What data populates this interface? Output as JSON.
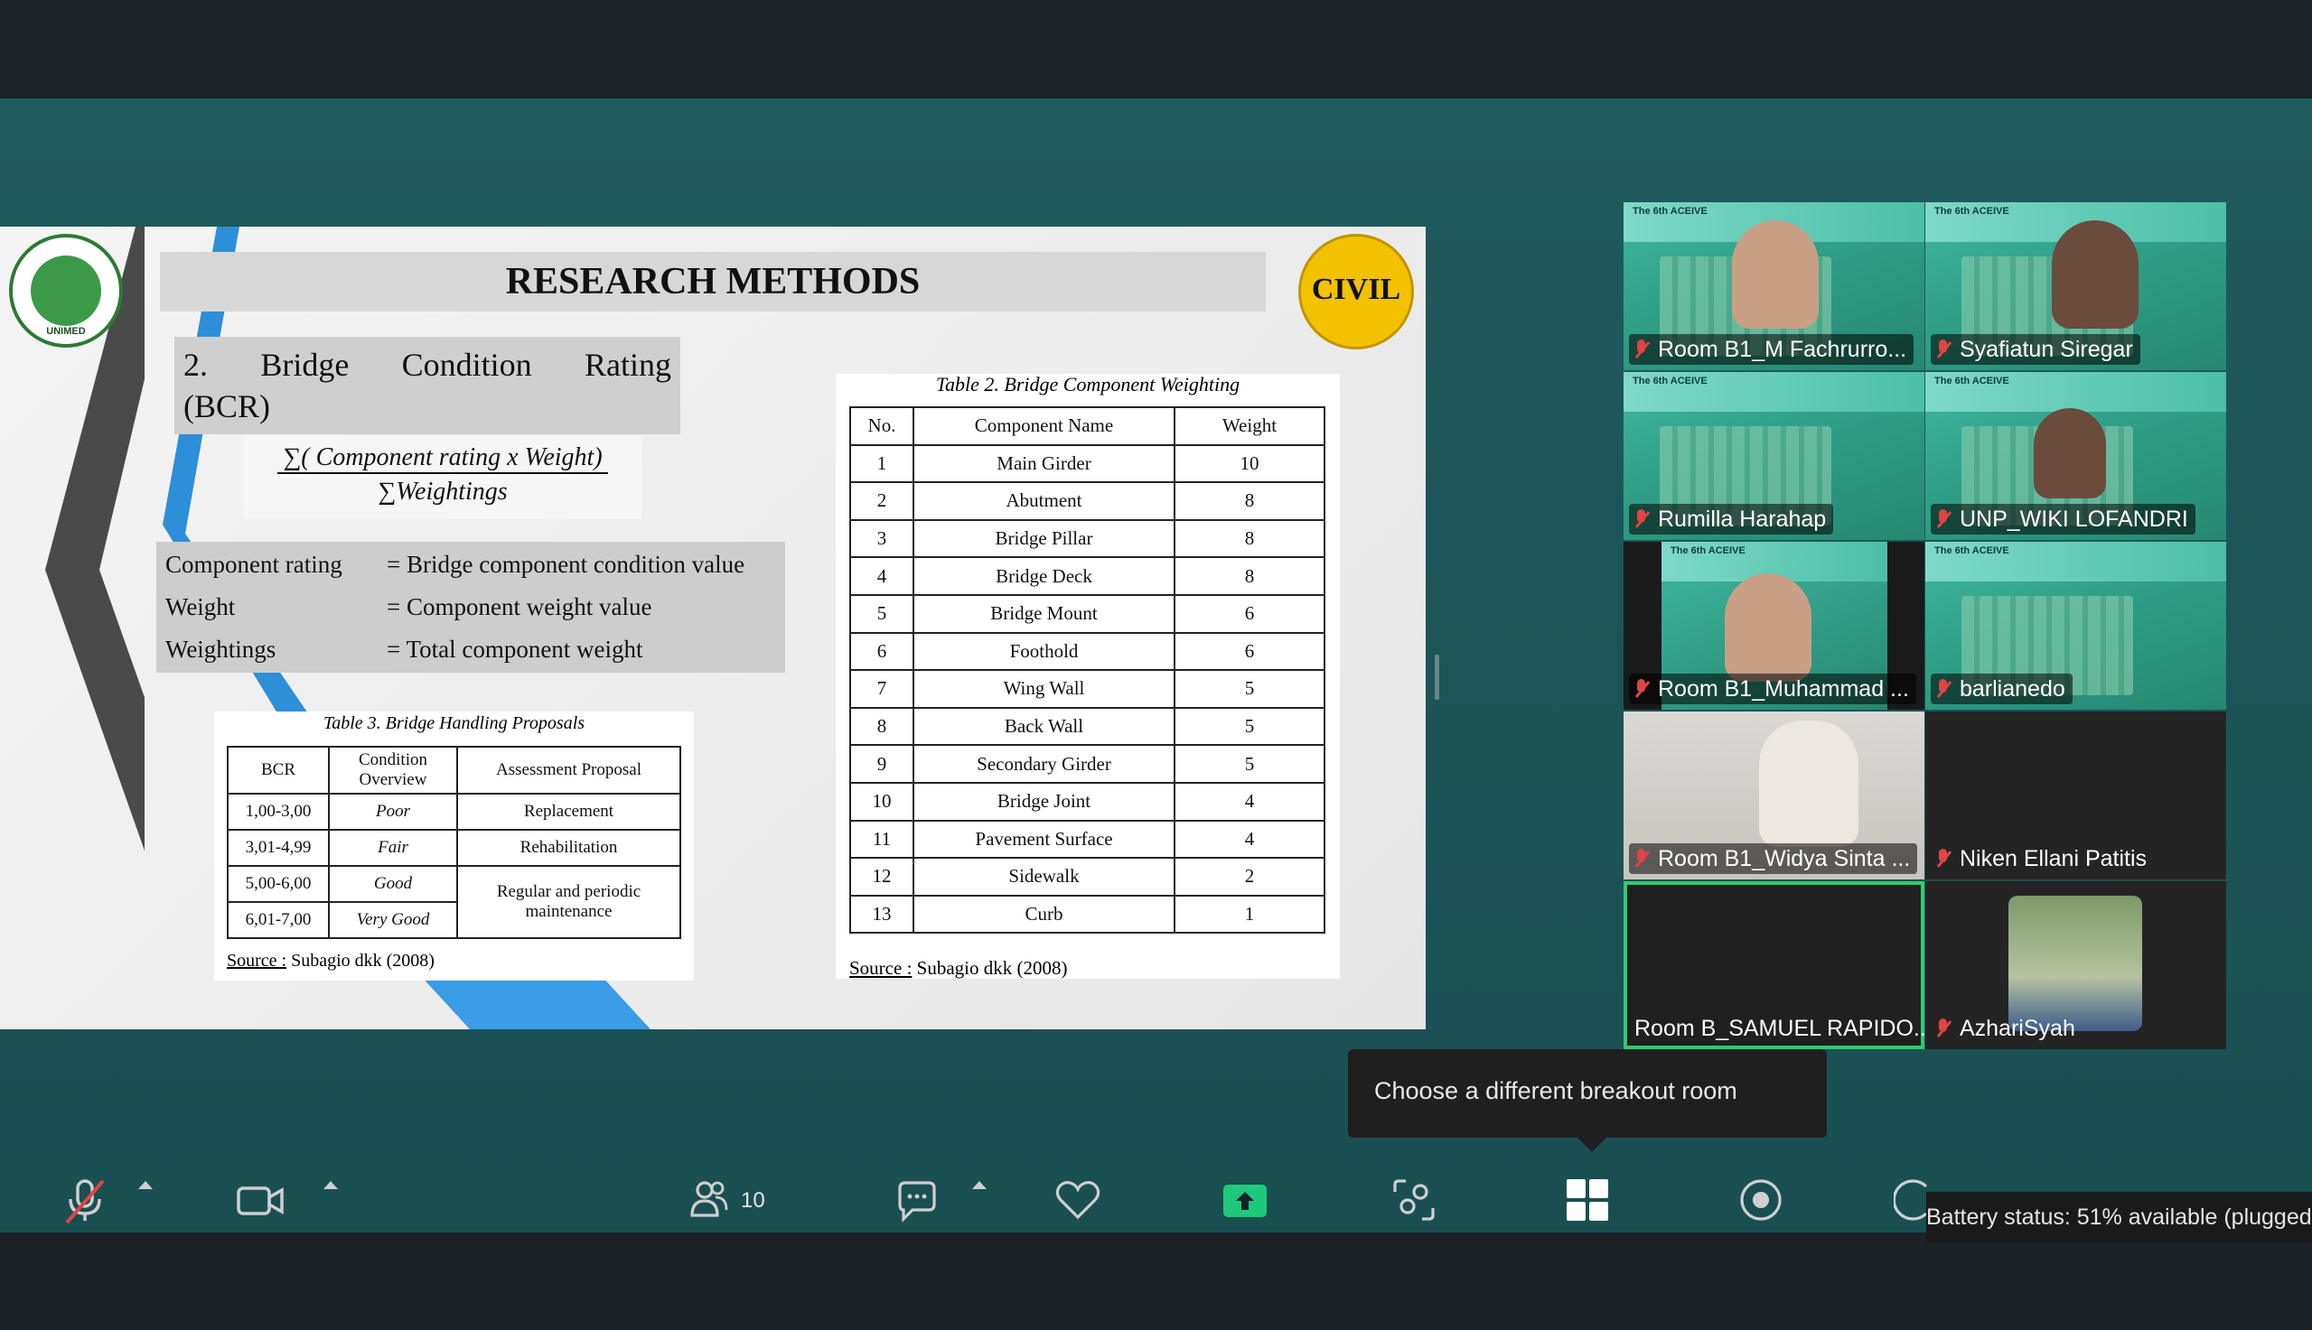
{
  "slide": {
    "title": "RESEARCH METHODS",
    "logo_left_text": "UNIMED",
    "logo_right_text": "CIVIL",
    "heading_line1": [
      "2.",
      "Bridge",
      "Condition",
      "Rating"
    ],
    "heading_line2": "(BCR)",
    "formula_numerator": "∑( Component rating x Weight)",
    "formula_denominator": "∑Weightings",
    "definitions": [
      {
        "term": "Component rating",
        "def": "= Bridge component condition value"
      },
      {
        "term": "Weight",
        "def": "= Component weight value"
      },
      {
        "term": "Weightings",
        "def": "= Total component weight"
      }
    ],
    "table2": {
      "title": "Table 2. Bridge Component Weighting",
      "headers": [
        "No.",
        "Component Name",
        "Weight"
      ],
      "rows": [
        [
          "1",
          "Main Girder",
          "10"
        ],
        [
          "2",
          "Abutment",
          "8"
        ],
        [
          "3",
          "Bridge Pillar",
          "8"
        ],
        [
          "4",
          "Bridge Deck",
          "8"
        ],
        [
          "5",
          "Bridge Mount",
          "6"
        ],
        [
          "6",
          "Foothold",
          "6"
        ],
        [
          "7",
          "Wing Wall",
          "5"
        ],
        [
          "8",
          "Back Wall",
          "5"
        ],
        [
          "9",
          "Secondary Girder",
          "5"
        ],
        [
          "10",
          "Bridge Joint",
          "4"
        ],
        [
          "11",
          "Pavement Surface",
          "4"
        ],
        [
          "12",
          "Sidewalk",
          "2"
        ],
        [
          "13",
          "Curb",
          "1"
        ]
      ],
      "source_label": "Source :",
      "source_text": " Subagio dkk (2008)"
    },
    "table3": {
      "title": "Table 3. Bridge Handling Proposals",
      "headers": [
        "BCR",
        "Condition Overview",
        "Assessment Proposal"
      ],
      "rows": [
        [
          "1,00-3,00",
          "Poor",
          "Replacement"
        ],
        [
          "3,01-4,99",
          "Fair",
          "Rehabilitation"
        ],
        [
          "5,00-6,00",
          "Good",
          "Regular and periodic maintenance"
        ],
        [
          "6,01-7,00",
          "Very Good",
          ""
        ]
      ],
      "source_label": "Source :",
      "source_text": " Subagio dkk (2008)"
    }
  },
  "participants": [
    {
      "name": "Room B1_M Fachrurro...",
      "muted": true
    },
    {
      "name": "Syafiatun Siregar",
      "muted": true
    },
    {
      "name": "Rumilla Harahap",
      "muted": true
    },
    {
      "name": "UNP_WIKI LOFANDRI",
      "muted": true
    },
    {
      "name": "Room B1_Muhammad ...",
      "muted": true
    },
    {
      "name": "barlianedo",
      "muted": true
    },
    {
      "name": "Room B1_Widya Sinta ...",
      "muted": true
    },
    {
      "name": "Niken Ellani Patitis",
      "muted": true
    },
    {
      "name": "Room B_SAMUEL RAPIDO...",
      "muted": false
    },
    {
      "name": "AzhariSyah",
      "muted": true
    }
  ],
  "tile_banner": "The 6th ACEIVE",
  "tooltip": "Choose a different breakout room",
  "toolbar": {
    "participants_count": "10",
    "battery_status": "Battery status: 51% available (plugged"
  },
  "colors": {
    "stage": "#1f5a5c",
    "accent_green": "#2ecc71",
    "share_green": "#1ec97a",
    "mute_red": "#e04444"
  }
}
